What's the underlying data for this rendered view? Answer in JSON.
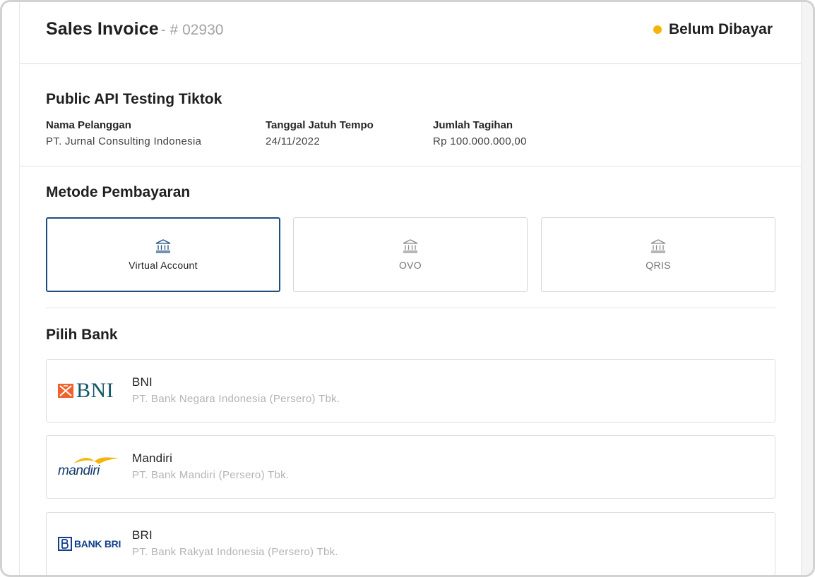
{
  "header": {
    "title": "Sales Invoice",
    "invoice_number": "- # 02930",
    "status": "Belum Dibayar",
    "status_color": "#f5b40b"
  },
  "invoice": {
    "title": "Public API Testing Tiktok",
    "fields": [
      {
        "label": "Nama Pelanggan",
        "value": "PT. Jurnal Consulting Indonesia"
      },
      {
        "label": "Tanggal Jatuh Tempo",
        "value": "24/11/2022"
      },
      {
        "label": "Jumlah Tagihan",
        "value": "Rp 100.000.000,00"
      }
    ]
  },
  "payment": {
    "title": "Metode Pembayaran",
    "accent_color": "#1d4e80",
    "methods": [
      {
        "label": "Virtual Account",
        "icon": "bank-icon",
        "selected": true
      },
      {
        "label": "OVO",
        "icon": "bank-icon",
        "selected": false
      },
      {
        "label": "QRIS",
        "icon": "bank-icon",
        "selected": false
      }
    ]
  },
  "banks": {
    "title": "Pilih Bank",
    "items": [
      {
        "name": "BNI",
        "description": "PT. Bank Negara Indonesia (Persero) Tbk.",
        "logo_text": "BNI",
        "logo_color": "#11586b",
        "logo_mark_color": "#f0612c"
      },
      {
        "name": "Mandiri",
        "description": "PT. Bank Mandiri (Persero) Tbk.",
        "logo_text": "mandiri",
        "logo_color": "#123a6b",
        "logo_mark_color": "#f5b40b"
      },
      {
        "name": "BRI",
        "description": "PT. Bank Rakyat Indonesia (Persero) Tbk.",
        "logo_text": "BANK BRI",
        "logo_color": "#123f8c"
      }
    ]
  }
}
